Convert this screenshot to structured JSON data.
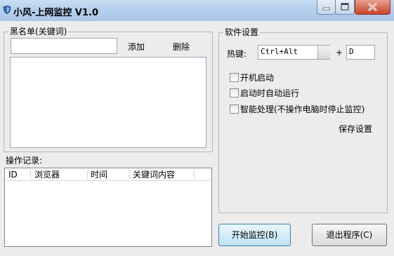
{
  "window": {
    "title": "小风-上网监控 V1.0"
  },
  "blacklist": {
    "legend": "黑名单(关键词)",
    "input_value": "",
    "add_label": "添加",
    "delete_label": "删除"
  },
  "log": {
    "label": "操作记录:",
    "columns": [
      "ID",
      "浏览器",
      "时间",
      "关键词内容"
    ]
  },
  "settings": {
    "legend": "软件设置",
    "hotkey_label": "热键:",
    "hotkey_modifier": "Ctrl+Alt",
    "plus": "+",
    "hotkey_key": "D",
    "options": [
      {
        "label": "开机启动",
        "checked": false
      },
      {
        "label": "启动时自动运行",
        "checked": false
      },
      {
        "label": "智能处理(不操作电脑时停止监控)",
        "checked": false
      }
    ],
    "save_label": "保存设置"
  },
  "buttons": {
    "start": "开始监控(B)",
    "exit": "退出程序(C)"
  },
  "colors": {
    "accent": "#3c7fb1",
    "close": "#c6442b"
  }
}
